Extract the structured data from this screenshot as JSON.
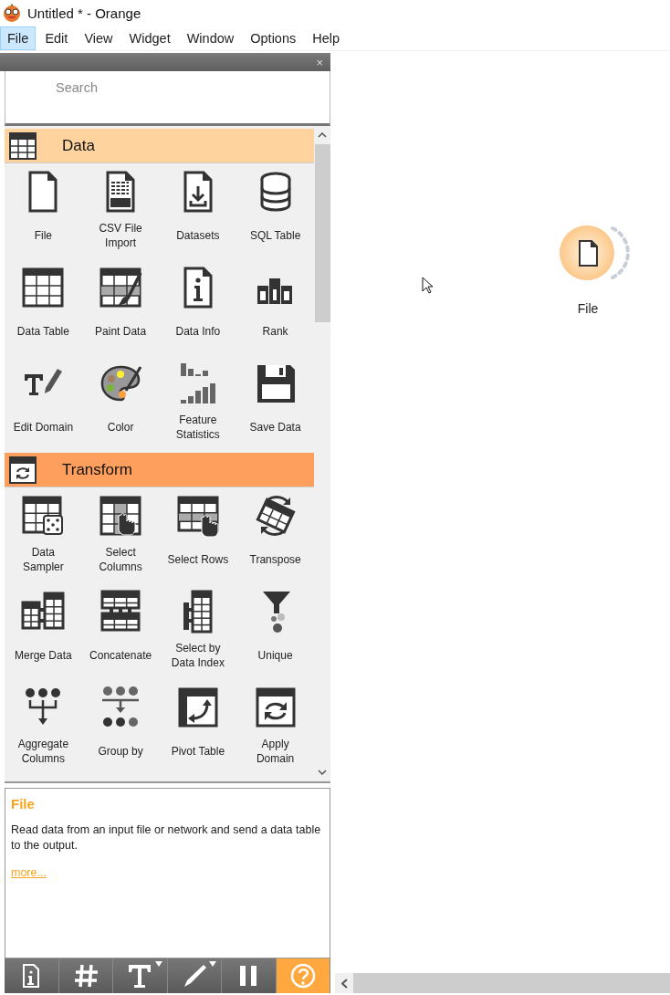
{
  "window": {
    "title": "Untitled * - Orange"
  },
  "menu": [
    {
      "label": "File",
      "selected": true
    },
    {
      "label": "Edit",
      "selected": false
    },
    {
      "label": "View",
      "selected": false
    },
    {
      "label": "Widget",
      "selected": false
    },
    {
      "label": "Window",
      "selected": false
    },
    {
      "label": "Options",
      "selected": false
    },
    {
      "label": "Help",
      "selected": false
    }
  ],
  "dock": {
    "close": "×",
    "search": {
      "placeholder": "Search"
    },
    "categories": [
      {
        "name": "Data",
        "color": "#fed39e",
        "widgets": [
          {
            "label": "File"
          },
          {
            "label": "CSV File Import"
          },
          {
            "label": "Datasets"
          },
          {
            "label": "SQL Table"
          },
          {
            "label": "Data Table"
          },
          {
            "label": "Paint Data"
          },
          {
            "label": "Data Info"
          },
          {
            "label": "Rank"
          },
          {
            "label": "Edit Domain"
          },
          {
            "label": "Color"
          },
          {
            "label": "Feature Statistics"
          },
          {
            "label": "Save Data"
          }
        ]
      },
      {
        "name": "Transform",
        "color": "#ff9f5d",
        "widgets": [
          {
            "label": "Data Sampler"
          },
          {
            "label": "Select Columns"
          },
          {
            "label": "Select Rows"
          },
          {
            "label": "Transpose"
          },
          {
            "label": "Merge Data"
          },
          {
            "label": "Concatenate"
          },
          {
            "label": "Select by Data Index"
          },
          {
            "label": "Unique"
          },
          {
            "label": "Aggregate Columns"
          },
          {
            "label": "Group by"
          },
          {
            "label": "Pivot Table"
          },
          {
            "label": "Apply Domain"
          }
        ]
      }
    ],
    "description": {
      "title": "File",
      "text": "Read data from an input file or network and send a data table to the output.",
      "link": "more..."
    },
    "toolbar": [
      {
        "kind": "info",
        "menu": false,
        "checked": false
      },
      {
        "kind": "grid",
        "menu": false,
        "checked": false
      },
      {
        "kind": "text",
        "menu": true,
        "checked": false
      },
      {
        "kind": "pen",
        "menu": true,
        "checked": false
      },
      {
        "kind": "pause",
        "menu": false,
        "checked": false
      },
      {
        "kind": "help",
        "menu": false,
        "checked": true
      }
    ]
  },
  "canvas": {
    "nodes": [
      {
        "label": "File"
      }
    ]
  }
}
